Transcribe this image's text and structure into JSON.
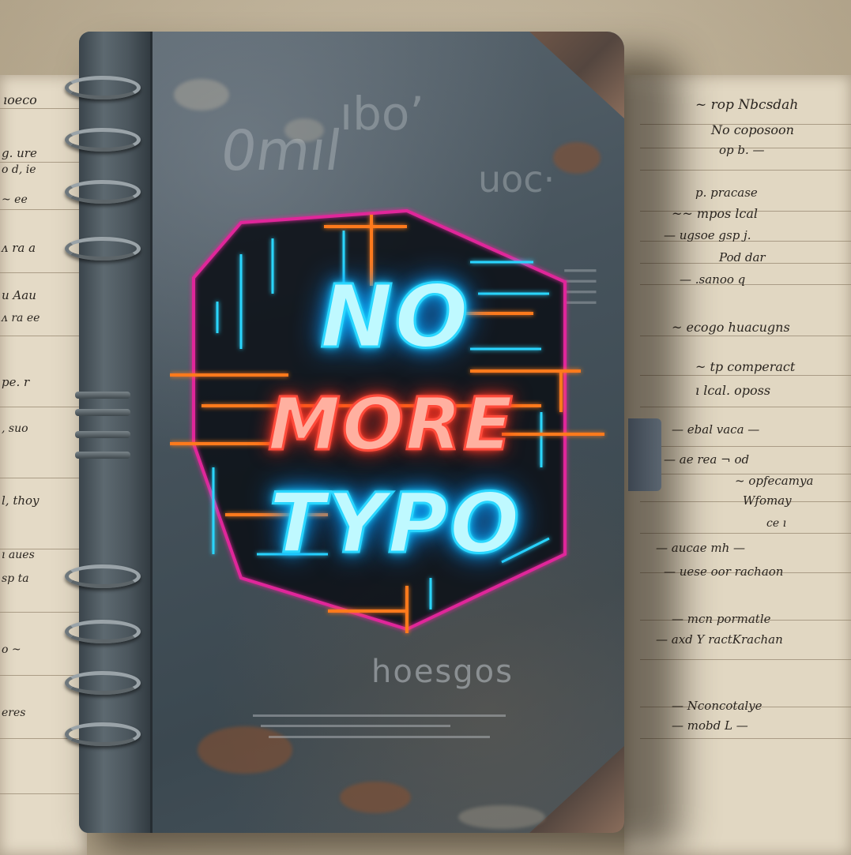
{
  "cover": {
    "line1": "NO",
    "line2": "MORE",
    "line3": "TYPO"
  },
  "colors": {
    "neon_cyan": "#29d6ff",
    "neon_red": "#ff4a3a",
    "neon_orange": "#ff7a1a",
    "neon_magenta": "#e0289a",
    "cover": "#46535c"
  }
}
